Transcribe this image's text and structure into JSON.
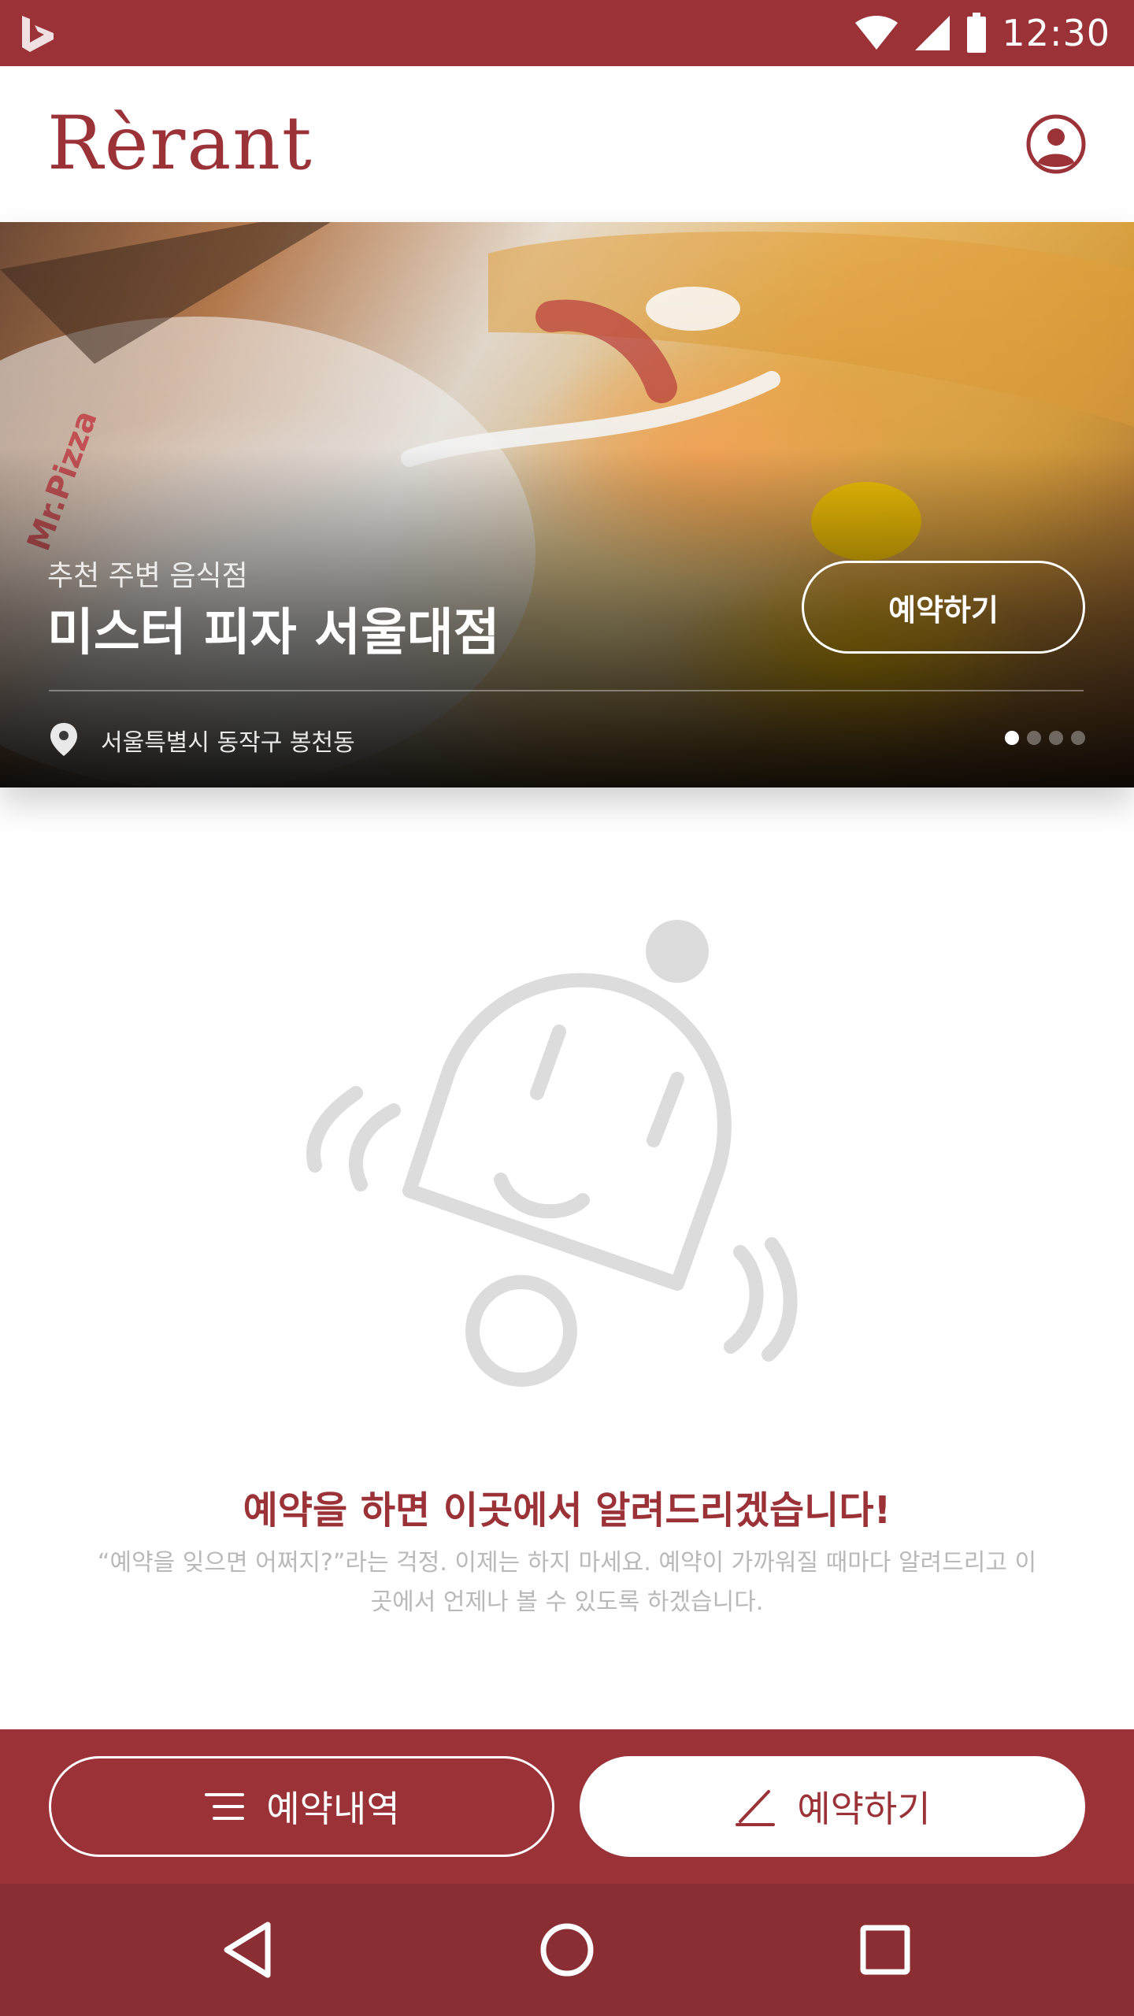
{
  "status_bar": {
    "time": "12:30",
    "icons": [
      "bing-icon",
      "wifi-icon",
      "signal-icon",
      "battery-icon"
    ]
  },
  "app_bar": {
    "logo": "Rèrant",
    "profile_icon": "account-circle-icon"
  },
  "hero": {
    "subtitle": "추천 주변 음식점",
    "title": "미스터 피자 서울대점",
    "reserve_label": "예약하기",
    "address": "서울특별시 동작구 봉천동",
    "pin_icon": "location-pin-icon",
    "page_count": 4,
    "active_page": 1
  },
  "empty_state": {
    "illustration": "bell-character-icon",
    "title": "예약을 하면 이곳에서 알려드리겠습니다!",
    "description": "“예약을 잊으면 어쩌지?”라는 걱정. 이제는 하지 마세요. 예약이 가까워질 때마다 알려드리고 이곳에서 언제나 볼 수 있도록 하겠습니다."
  },
  "actions": {
    "history_label": "예약내역",
    "history_icon": "list-icon",
    "reserve_label": "예약하기",
    "reserve_icon": "pencil-icon"
  },
  "nav": {
    "back": "back-triangle-icon",
    "home": "home-circle-icon",
    "recents": "recents-square-icon"
  },
  "colors": {
    "brand": "#9b3238",
    "nav_bar": "#8a2e33",
    "muted_text": "#b9b9b9",
    "illustration": "#dcdcdc"
  }
}
